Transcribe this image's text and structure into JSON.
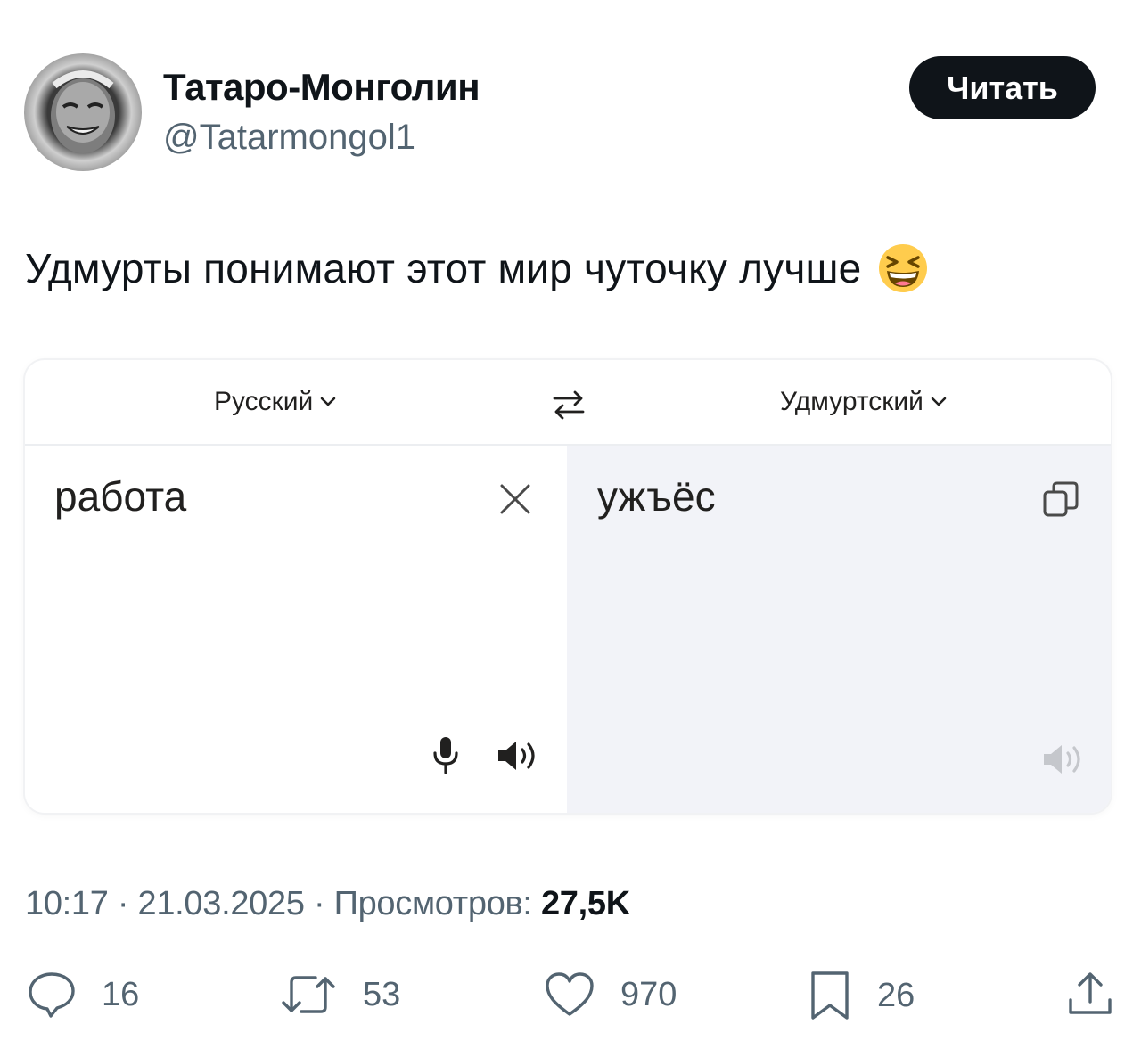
{
  "author": {
    "display_name": "Татаро-Монголин",
    "handle": "@Tatarmongol1",
    "follow_label": "Читать"
  },
  "tweet": {
    "text": "Удмурты понимают этот мир чуточку лучше",
    "emoji": "laughing-face"
  },
  "translator": {
    "source_lang": "Русский",
    "target_lang": "Удмуртский",
    "source_text": "работа",
    "translated_text": "ужъёс"
  },
  "meta": {
    "time": "10:17",
    "date": "21.03.2025",
    "separator": "·",
    "views_label": "Просмотров:",
    "views_count": "27,5K"
  },
  "actions": {
    "replies": "16",
    "retweets": "53",
    "likes": "970",
    "bookmarks": "26"
  },
  "colors": {
    "text": "#0f1419",
    "secondary": "#536471",
    "button_bg": "#0f1419",
    "translation_bg": "#f2f3f8"
  }
}
